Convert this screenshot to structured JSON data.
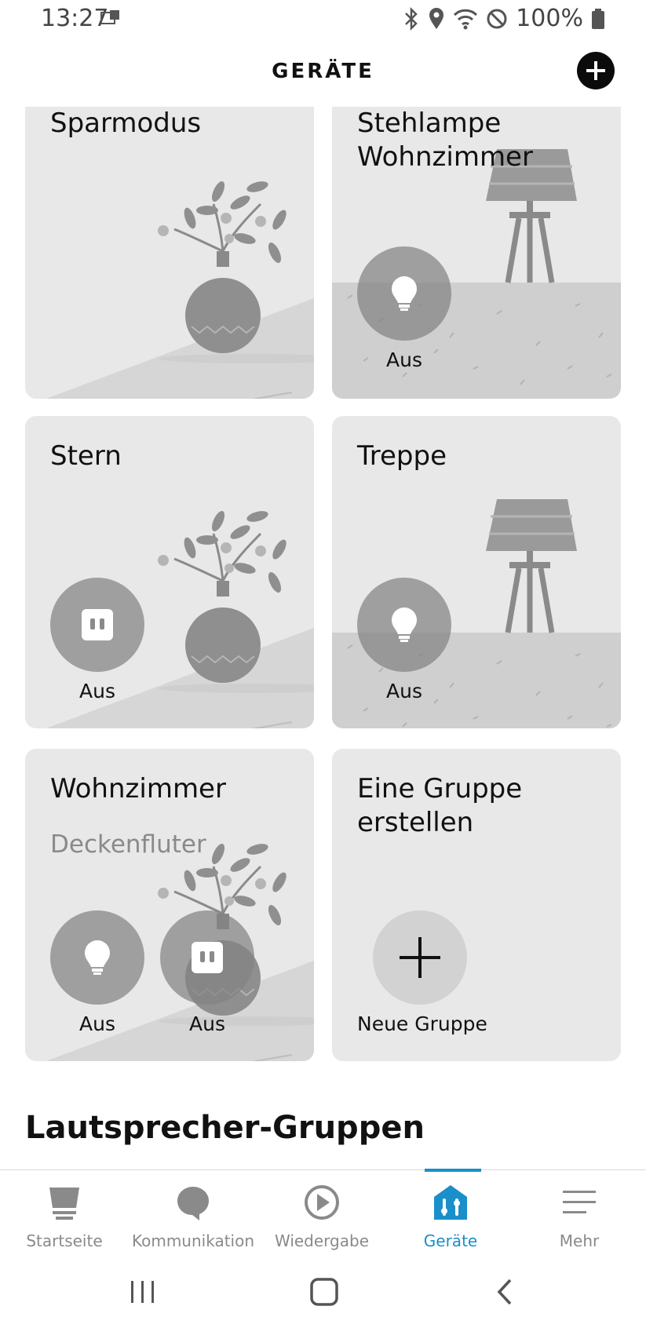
{
  "status_bar": {
    "time": "13:27",
    "battery": "100%",
    "icons": [
      "notification-icon",
      "bluetooth-icon",
      "location-icon",
      "wifi-icon",
      "do-not-disturb-icon",
      "battery-icon"
    ]
  },
  "header": {
    "title": "GERÄTE",
    "add_icon": "plus-icon"
  },
  "cards": [
    {
      "title": "Sparmodus",
      "subtitle": "",
      "illustration": "plant-vase",
      "devices": []
    },
    {
      "title": "Stehlampe\nWohnzimmer",
      "subtitle": "",
      "illustration": "floor-lamp",
      "devices": [
        {
          "icon": "bulb-icon",
          "status": "Aus"
        }
      ]
    },
    {
      "title": "Stern",
      "subtitle": "",
      "illustration": "plant-vase",
      "devices": [
        {
          "icon": "plug-icon",
          "status": "Aus"
        }
      ]
    },
    {
      "title": "Treppe",
      "subtitle": "",
      "illustration": "floor-lamp",
      "devices": [
        {
          "icon": "bulb-icon",
          "status": "Aus"
        }
      ]
    },
    {
      "title": "Wohnzimmer",
      "subtitle": "Deckenfluter",
      "illustration": "plant-vase",
      "devices": [
        {
          "icon": "bulb-icon",
          "status": "Aus"
        },
        {
          "icon": "plug-icon",
          "status": "Aus"
        }
      ]
    },
    {
      "title": "Eine Gruppe\nerstellen",
      "subtitle": "",
      "illustration": "none",
      "action_label": "Neue Gruppe",
      "action_icon": "plus-icon"
    }
  ],
  "section_heading": "Lautsprecher-Gruppen",
  "bottom_nav": {
    "items": [
      {
        "label": "Startseite",
        "icon": "home-icon"
      },
      {
        "label": "Kommunikation",
        "icon": "chat-bubble-icon"
      },
      {
        "label": "Wiedergabe",
        "icon": "play-icon"
      },
      {
        "label": "Geräte",
        "icon": "devices-icon",
        "active": true
      },
      {
        "label": "Mehr",
        "icon": "menu-icon"
      }
    ],
    "active_color": "#1a8fc9",
    "inactive_color": "#8a8a8a"
  },
  "android_nav": {
    "buttons": [
      "recent-apps-icon",
      "home-button-icon",
      "back-icon"
    ]
  }
}
